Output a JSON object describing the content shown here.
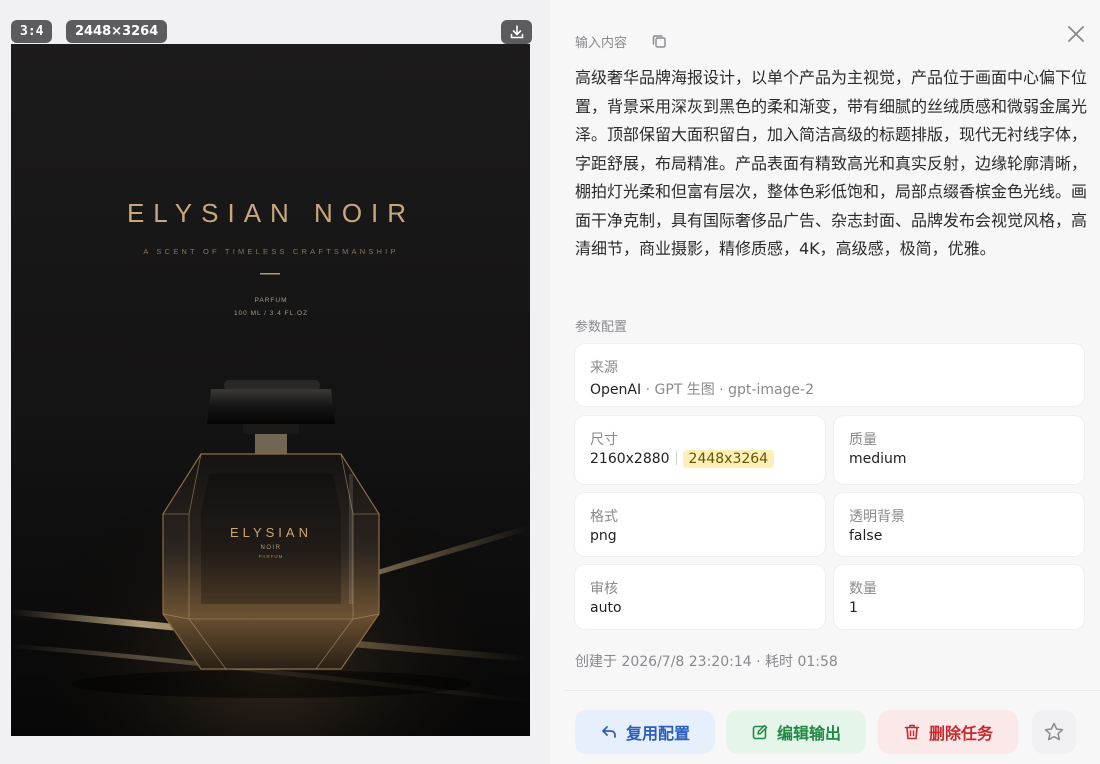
{
  "preview": {
    "ratio_badge": "3:4",
    "resolution_badge": "2448×3264",
    "download_icon": "download-icon",
    "poster": {
      "brand": "ELYSIAN NOIR",
      "tagline": "A SCENT OF TIMELESS CRAFTSMANSHIP",
      "product_type": "PARFUM",
      "volume": "100 ML / 3.4 FL.OZ",
      "bottle_brand": "ELYSIAN",
      "bottle_sub": "NOIR",
      "bottle_type": "PARFUM"
    }
  },
  "details": {
    "close_icon": "close-icon",
    "input_section_title": "输入内容",
    "copy_icon": "copy-icon",
    "prompt": "高级奢华品牌海报设计，以单个产品为主视觉，产品位于画面中心偏下位置，背景采用深灰到黑色的柔和渐变，带有细腻的丝绒质感和微弱金属光泽。顶部保留大面积留白，加入简洁高级的标题排版，现代无衬线字体，字距舒展，布局精准。产品表面有精致高光和真实反射，边缘轮廓清晰，棚拍灯光柔和但富有层次，整体色彩低饱和，局部点缀香槟金色光线。画面干净克制，具有国际奢侈品广告、杂志封面、品牌发布会视觉风格，高清细节，商业摄影，精修质感，4K，高级感，极简，优雅。",
    "params_section_title": "参数配置",
    "source": {
      "label": "来源",
      "provider": "OpenAI",
      "dot1": "·",
      "mode": "GPT 生图",
      "dot2": "·",
      "model": "gpt-image-2"
    },
    "size": {
      "label": "尺寸",
      "value": "2160x2880",
      "actual": "2448x3264"
    },
    "quality": {
      "label": "质量",
      "value": "medium"
    },
    "format": {
      "label": "格式",
      "value": "png"
    },
    "transparent": {
      "label": "透明背景",
      "value": "false"
    },
    "moderation": {
      "label": "审核",
      "value": "auto"
    },
    "count": {
      "label": "数量",
      "value": "1"
    },
    "created": "创建于 2026/7/8 23:20:14 · 耗时 01:58"
  },
  "actions": {
    "reuse_label": "复用配置",
    "edit_label": "编辑输出",
    "delete_label": "删除任务",
    "reuse_icon": "undo-arrow-icon",
    "edit_icon": "edit-icon",
    "delete_icon": "trash-icon",
    "star_icon": "star-icon"
  },
  "colors": {
    "accent_blue": "#2b5fbf",
    "accent_green": "#1f8a43",
    "accent_red": "#c8282e",
    "highlight": "#fbf1b8",
    "gold": "#c9a77a"
  }
}
